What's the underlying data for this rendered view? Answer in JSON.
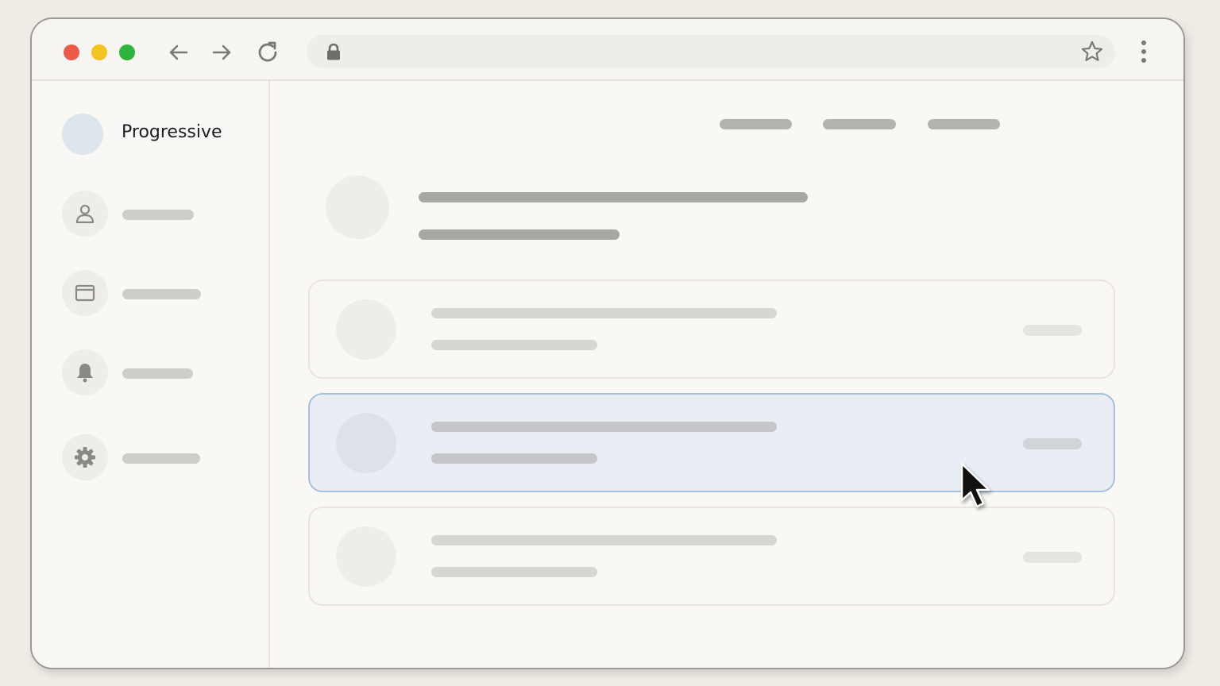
{
  "brand": {
    "name": "Progressive"
  },
  "toolbar": {
    "traffic_lights": {
      "close": "#ec5a4a",
      "minimize": "#f3c321",
      "maximize": "#2fb33d"
    },
    "icons": [
      "arrow-left-icon",
      "arrow-right-icon",
      "reload-icon",
      "lock-icon",
      "star-icon",
      "kebab-menu-icon"
    ]
  },
  "sidebar": {
    "items": [
      {
        "icon": "user-icon"
      },
      {
        "icon": "browser-window-icon"
      },
      {
        "icon": "bell-icon"
      },
      {
        "icon": "gear-icon"
      }
    ]
  },
  "main": {
    "cards": [
      {
        "state": "default"
      },
      {
        "state": "selected"
      },
      {
        "state": "default"
      }
    ]
  },
  "colors": {
    "selected_card_bg": "#e9eef4",
    "selected_card_border": "#a9bfd6",
    "brand_avatar": "#dde5ed"
  }
}
